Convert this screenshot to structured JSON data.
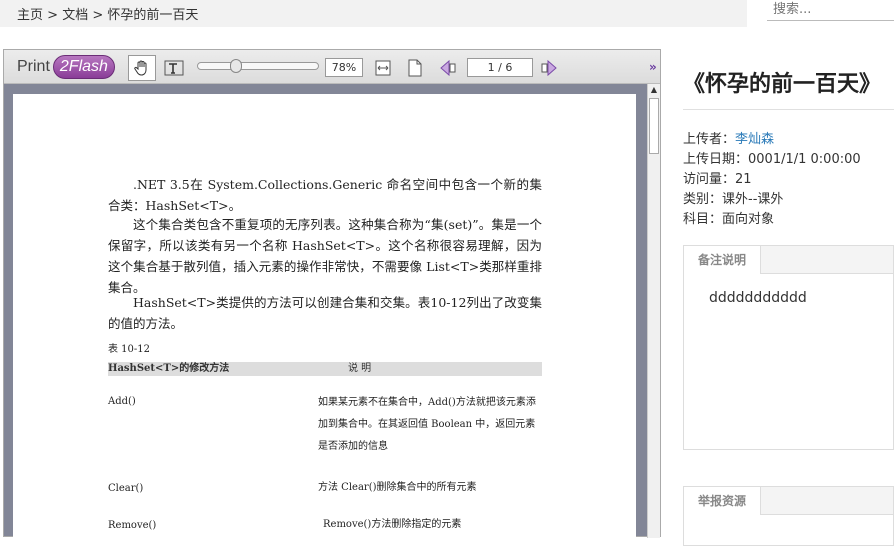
{
  "breadcrumb": {
    "home": "主页",
    "sep1": " > ",
    "docs": "文档",
    "sep2": " > ",
    "current": "怀孕的前一百天"
  },
  "search": {
    "placeholder": "搜索..."
  },
  "viewer": {
    "logo_print": "Print",
    "logo_badge": "2Flash",
    "zoom": "78%",
    "page": "1 / 6",
    "more": "»",
    "zoom_level": 0.3,
    "icons": [
      "hand-tool-icon",
      "text-select-icon",
      "fit-width-icon",
      "fit-page-icon",
      "prev-page-icon",
      "next-page-icon"
    ]
  },
  "document": {
    "p1": ".NET 3.5在 System.Collections.Generic 命名空间中包含一个新的集合类：HashSet<T>。",
    "p2": "这个集合类包含不重复项的无序列表。这种集合称为“集(set)”。集是一个保留字，所以该类有另一个名称 HashSet<T>。这个名称很容易理解，因为这个集合基于散列值，插入元素的操作非常快，不需要像 List<T>类那样重排集合。",
    "p3": "HashSet<T>类提供的方法可以创建合集和交集。表10-12列出了改变集的值的方法。",
    "table_caption": "表  10-12",
    "table_head_1": "HashSet<T>的修改方法",
    "table_head_2": "说      明",
    "rows": [
      {
        "method": "Add()",
        "desc": "如果某元素不在集合中，Add()方法就把该元素添加到集合中。在其返回值 Boolean 中，返回元素是否添加的信息"
      },
      {
        "method": "Clear()",
        "desc": "方法 Clear()删除集合中的所有元素"
      },
      {
        "method": "Remove()",
        "desc": "Remove()方法删除指定的元素"
      }
    ]
  },
  "info": {
    "title": "《怀孕的前一百天》",
    "uploader_label": "上传者：",
    "uploader": "李灿森",
    "date_label": "上传日期：",
    "date": "0001/1/1 0:00:00",
    "views_label": "访问量：",
    "views": "21",
    "category_label": "类别：",
    "category": "课外--课外",
    "subject_label": "科目：",
    "subject": "面向对象"
  },
  "notes": {
    "tab": "备注说明",
    "content": "ddddddddddd"
  },
  "report": {
    "tab": "举报资源"
  },
  "colors": {
    "accent_purple": "#8a3d98",
    "link_blue": "#2a7ab8",
    "viewer_bg": "#828697"
  }
}
